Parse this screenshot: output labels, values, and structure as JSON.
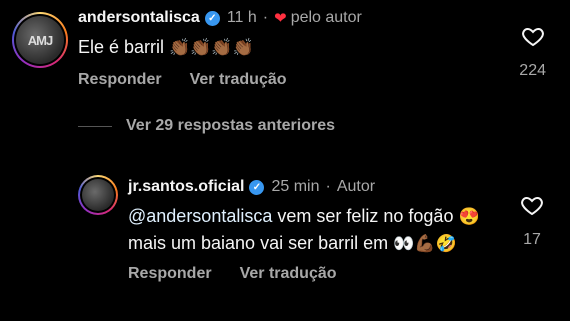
{
  "comments": [
    {
      "avatar_text": "AMJ",
      "username": "andersontalisca",
      "time": "11 h",
      "liked_by_author": "pelo autor",
      "text": "Ele é barril",
      "emojis": "👏🏾👏🏾👏🏾👏🏾",
      "reply_label": "Responder",
      "translate_label": "Ver tradução",
      "like_count": "224"
    },
    {
      "avatar_text": "",
      "username": "jr.santos.oficial",
      "time": "25 min",
      "author_tag": "Autor",
      "mention": "@andersontalisca",
      "text_part1": " vem ser feliz no fogão ",
      "emoji1": "😍",
      "text_part2": " mais um baiano vai ser barril em ",
      "emoji2": "👀💪🏾🤣",
      "reply_label": "Responder",
      "translate_label": "Ver tradução",
      "like_count": "17"
    }
  ],
  "view_replies": "Ver 29 respostas anteriores",
  "colors": {
    "accent_link": "#e0f1ff",
    "verified": "#3897f0",
    "heart_red": "#ff3040",
    "muted": "#a8a8a8"
  }
}
